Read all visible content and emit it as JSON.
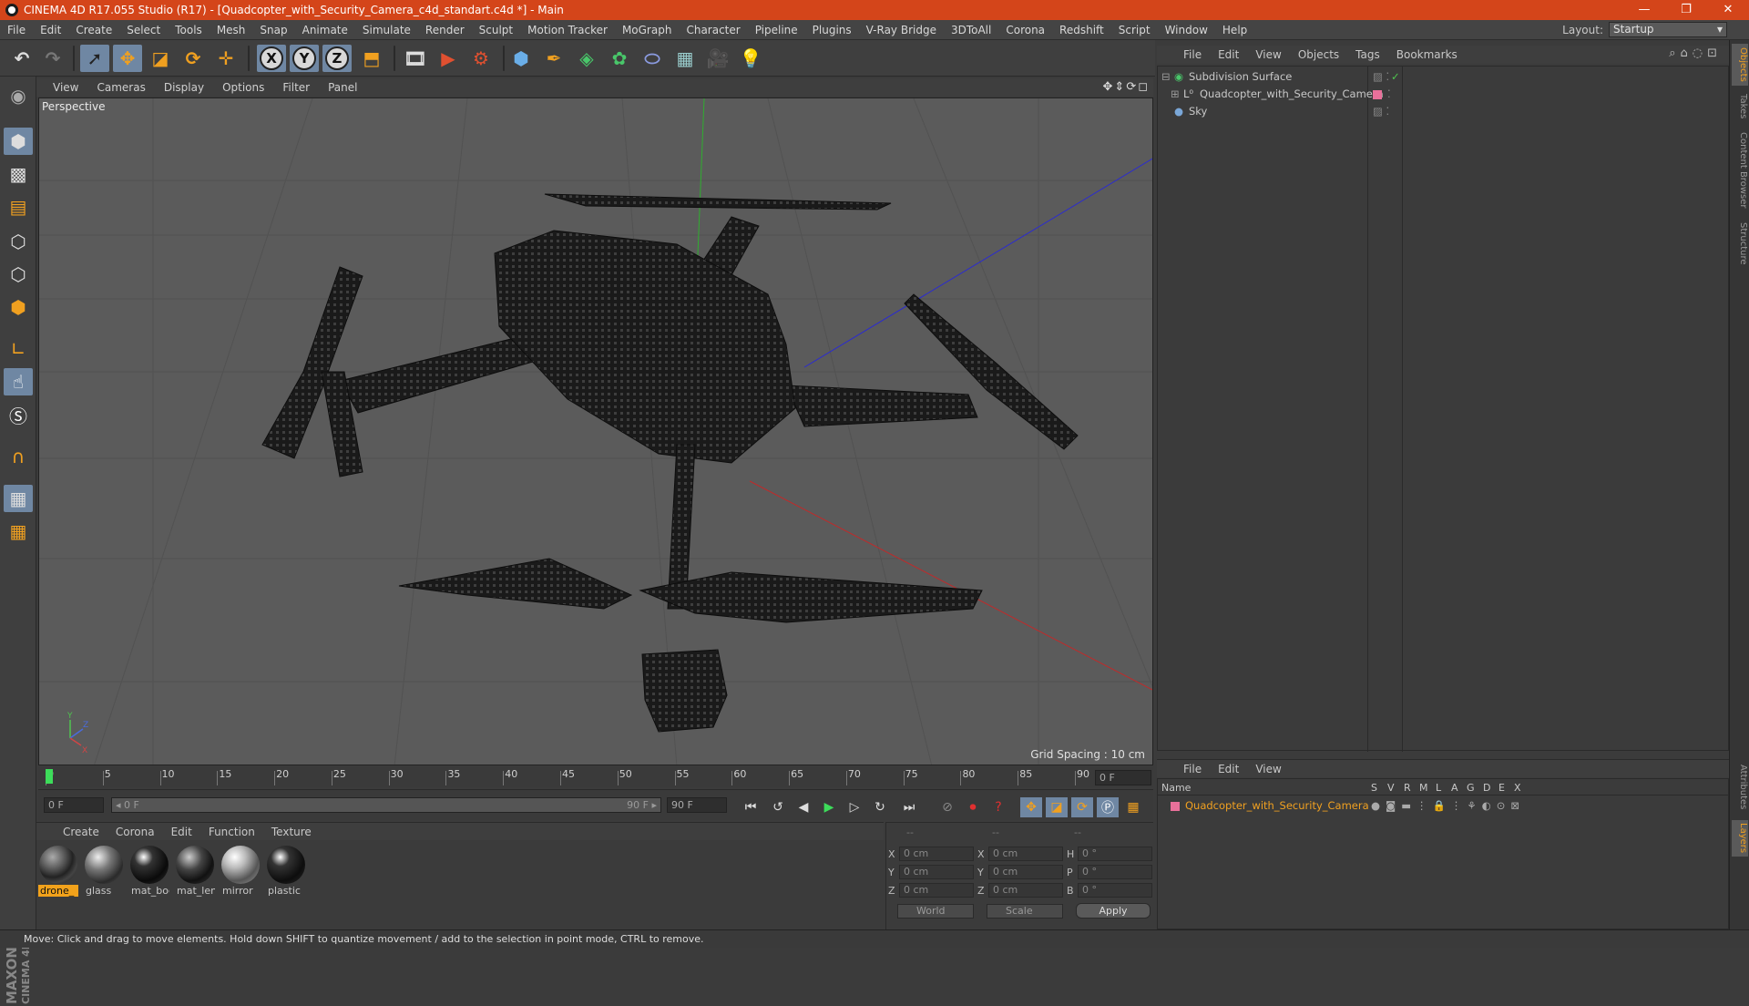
{
  "window": {
    "title": "CINEMA 4D R17.055 Studio (R17) - [Quadcopter_with_Security_Camera_c4d_standart.c4d *] - Main",
    "minimize": "—",
    "restore": "❐",
    "close": "✕"
  },
  "menu": [
    "File",
    "Edit",
    "Create",
    "Select",
    "Tools",
    "Mesh",
    "Snap",
    "Animate",
    "Simulate",
    "Render",
    "Sculpt",
    "Motion Tracker",
    "MoGraph",
    "Character",
    "Pipeline",
    "Plugins",
    "V-Ray Bridge",
    "3DToAll",
    "Corona",
    "Redshift",
    "Script",
    "Window",
    "Help"
  ],
  "layout": {
    "label": "Layout:",
    "value": "Startup"
  },
  "toolbar": {
    "x_label": "X",
    "y_label": "Y",
    "z_label": "Z"
  },
  "viewport": {
    "menu": [
      "View",
      "Cameras",
      "Display",
      "Options",
      "Filter",
      "Panel"
    ],
    "name": "Perspective",
    "grid_spacing": "Grid Spacing : 10 cm",
    "nav_icons": "✥⇕⟳◻",
    "axis_y": "Y",
    "axis_z": "Z",
    "axis_x": "X"
  },
  "timeline": {
    "ticks": [
      "0",
      "5",
      "10",
      "15",
      "20",
      "25",
      "30",
      "35",
      "40",
      "45",
      "50",
      "55",
      "60",
      "65",
      "70",
      "75",
      "80",
      "85",
      "90"
    ],
    "current_frame": "0 F",
    "start_frame": "0 F",
    "range_start": "◂ 0 F",
    "range_end": "90 F ▸",
    "end_frame": "90 F",
    "current_frame_field": "0 F"
  },
  "materials": {
    "menu": [
      "Create",
      "Corona",
      "Edit",
      "Function",
      "Texture"
    ],
    "items": [
      "drone_",
      "glass",
      "mat_boc",
      "mat_len",
      "mirror",
      "plastic"
    ]
  },
  "coords": {
    "head": [
      "--",
      "--",
      "--"
    ],
    "rows": [
      {
        "a": "X",
        "av": "0 cm",
        "b": "X",
        "bv": "0 cm",
        "c": "H",
        "cv": "0 °"
      },
      {
        "a": "Y",
        "av": "0 cm",
        "b": "Y",
        "bv": "0 cm",
        "c": "P",
        "cv": "0 °"
      },
      {
        "a": "Z",
        "av": "0 cm",
        "b": "Z",
        "bv": "0 cm",
        "c": "B",
        "cv": "0 °"
      }
    ],
    "world": "World",
    "scale": "Scale",
    "apply": "Apply"
  },
  "object_manager": {
    "menu": [
      "File",
      "Edit",
      "View",
      "Objects",
      "Tags",
      "Bookmarks"
    ],
    "objects": [
      "Subdivision Surface",
      "Quadcopter_with_Security_Camera",
      "Sky"
    ]
  },
  "layer_manager": {
    "menu": [
      "File",
      "Edit",
      "View"
    ],
    "name_header": "Name",
    "flags": [
      "S",
      "V",
      "R",
      "M",
      "L",
      "A",
      "G",
      "D",
      "E",
      "X"
    ],
    "layer": "Quadcopter_with_Security_Camera"
  },
  "side_tabs": [
    "Objects",
    "Takes",
    "Content Browser",
    "Structure",
    "Attributes",
    "Layers"
  ],
  "status": "Move: Click and drag to move elements. Hold down SHIFT to quantize movement / add to the selection in point mode, CTRL to remove.",
  "brand": {
    "maxon": "MAXON",
    "c4d": "CINEMA 4D"
  }
}
